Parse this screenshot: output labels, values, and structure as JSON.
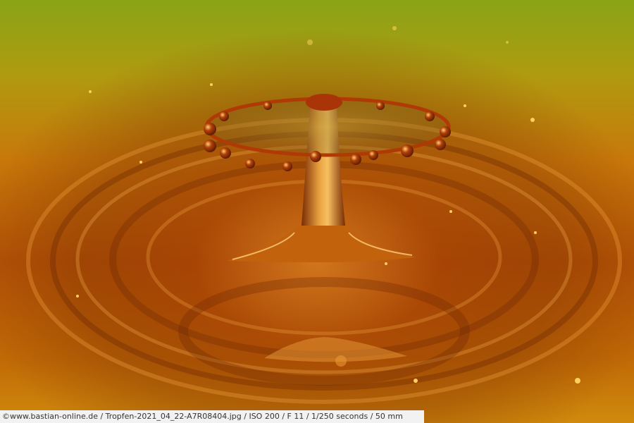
{
  "image": {
    "subject": "water-drop-splash",
    "palette": {
      "top": "#8ea81a",
      "mid": "#d07a08",
      "deep": "#8a3002",
      "highlight": "#ffd070"
    }
  },
  "caption": {
    "text": "©www.bastian-online.de / Tropfen-2021_04_22-A7R08404.jpg / ISO 200 / F 11 / 1/250 seconds  / 50 mm"
  }
}
